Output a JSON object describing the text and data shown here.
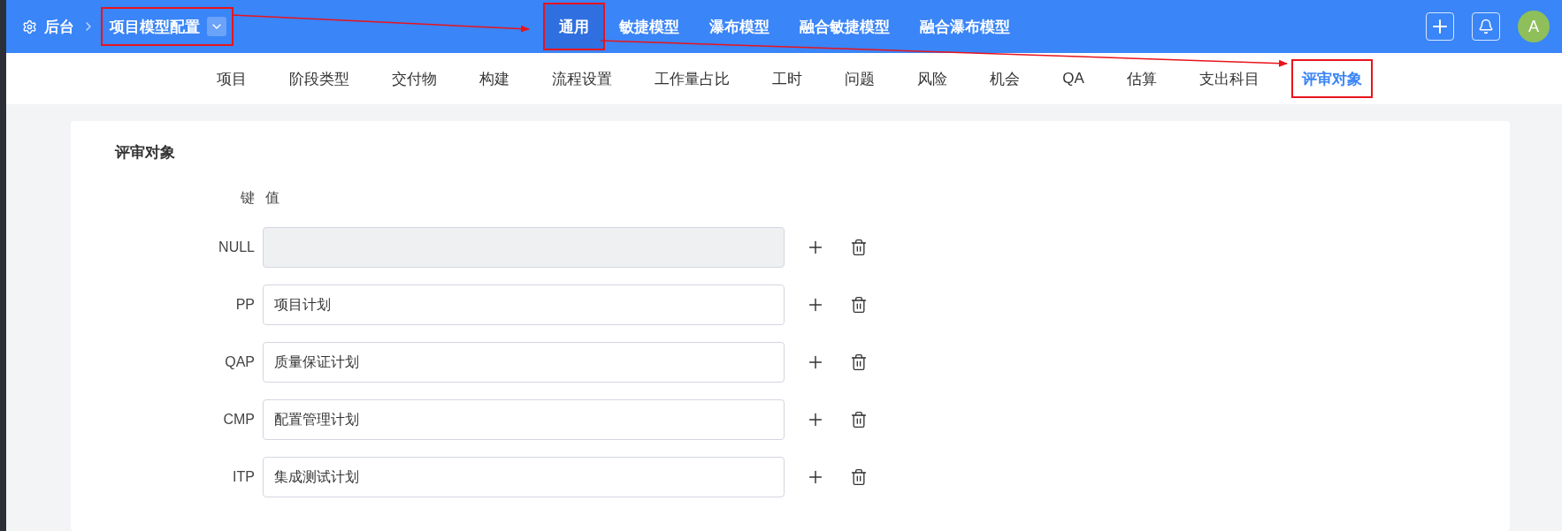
{
  "breadcrumb": {
    "root": "后台",
    "current": "项目模型配置",
    "annotated": true
  },
  "model_tabs": [
    {
      "label": "通用",
      "selected": true,
      "annotated": true
    },
    {
      "label": "敏捷模型",
      "selected": false,
      "annotated": false
    },
    {
      "label": "瀑布模型",
      "selected": false,
      "annotated": false
    },
    {
      "label": "融合敏捷模型",
      "selected": false,
      "annotated": false
    },
    {
      "label": "融合瀑布模型",
      "selected": false,
      "annotated": false
    }
  ],
  "user": {
    "avatar": "A"
  },
  "config_tabs": [
    {
      "label": "项目",
      "selected": false,
      "annotated": false
    },
    {
      "label": "阶段类型",
      "selected": false,
      "annotated": false
    },
    {
      "label": "交付物",
      "selected": false,
      "annotated": false
    },
    {
      "label": "构建",
      "selected": false,
      "annotated": false
    },
    {
      "label": "流程设置",
      "selected": false,
      "annotated": false
    },
    {
      "label": "工作量占比",
      "selected": false,
      "annotated": false
    },
    {
      "label": "工时",
      "selected": false,
      "annotated": false
    },
    {
      "label": "问题",
      "selected": false,
      "annotated": false
    },
    {
      "label": "风险",
      "selected": false,
      "annotated": false
    },
    {
      "label": "机会",
      "selected": false,
      "annotated": false
    },
    {
      "label": "QA",
      "selected": false,
      "annotated": false
    },
    {
      "label": "估算",
      "selected": false,
      "annotated": false
    },
    {
      "label": "支出科目",
      "selected": false,
      "annotated": false
    },
    {
      "label": "评审对象",
      "selected": true,
      "annotated": true
    }
  ],
  "section": {
    "title": "评审对象",
    "key_header": "键",
    "value_header": "值",
    "entries": [
      {
        "key": "NULL",
        "disabled": true
      },
      {
        "key": "PP",
        "value": "项目计划",
        "disabled": false
      },
      {
        "key": "QAP",
        "value": "质量保证计划",
        "disabled": false
      },
      {
        "key": "CMP",
        "value": "配置管理计划",
        "disabled": false
      },
      {
        "key": "ITP",
        "value": "集成测试计划",
        "disabled": false
      }
    ]
  }
}
